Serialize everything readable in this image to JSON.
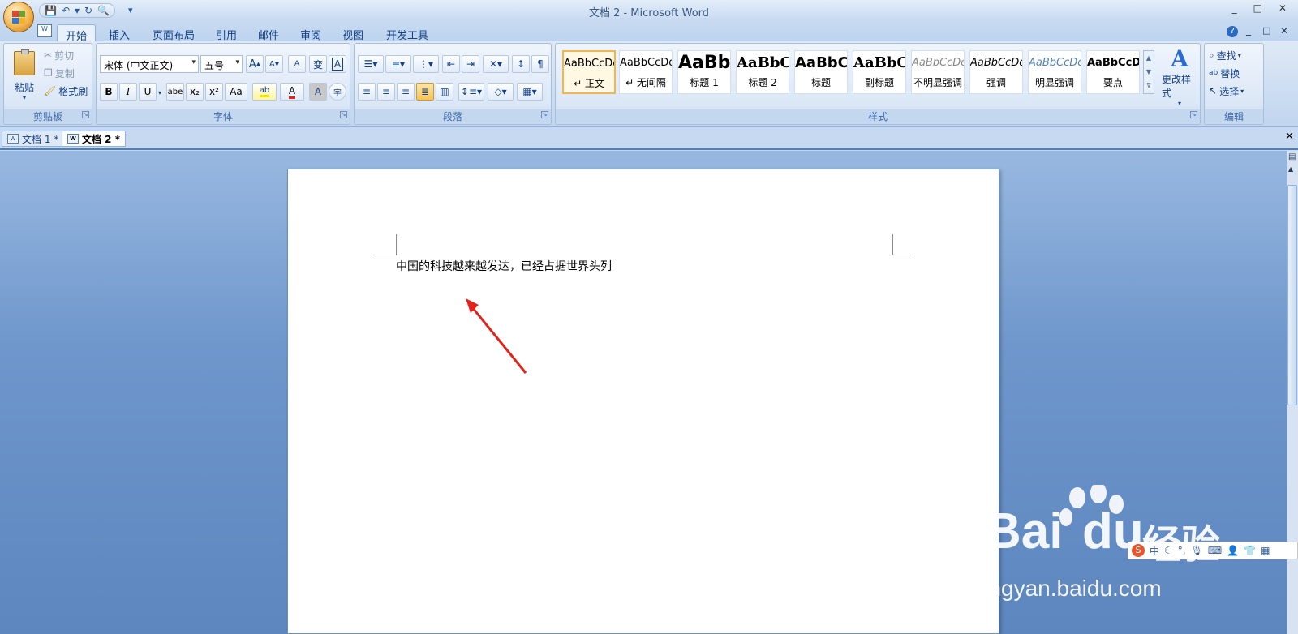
{
  "window": {
    "title": "文档 2 - Microsoft Word",
    "controls": [
      "_",
      "□",
      "✕"
    ]
  },
  "qat": {
    "save": "💾",
    "undo": "↶",
    "undo_menu": "▾",
    "redo": "↻",
    "preview": "🔍",
    "customize": "▾"
  },
  "tabs": [
    "开始",
    "插入",
    "页面布局",
    "引用",
    "邮件",
    "审阅",
    "视图",
    "开发工具"
  ],
  "ribbon_right": {
    "help": "?",
    "min": "_",
    "restore": "□",
    "close": "✕"
  },
  "clipboard": {
    "paste": "粘贴",
    "cut": "剪切",
    "copy": "复制",
    "format_painter": "格式刷",
    "caption": "剪贴板"
  },
  "font": {
    "name": "宋体 (中文正文)",
    "size": "五号",
    "grow": "A",
    "shrink": "A",
    "clear": "A",
    "pinyin": "wén",
    "phonetic": "变",
    "border": "A",
    "bold": "B",
    "italic": "I",
    "underline": "U",
    "strike": "abe",
    "sub": "x₂",
    "sup": "x²",
    "case": "Aa",
    "highlight": "ab",
    "color": "A",
    "shade": "A",
    "enclose": "字",
    "caption": "字体"
  },
  "paragraph": {
    "caption": "段落"
  },
  "styles": {
    "items": [
      {
        "sample": "AaBbCcDd",
        "label": "↵ 正文"
      },
      {
        "sample": "AaBbCcDd",
        "label": "↵ 无间隔"
      },
      {
        "sample": "AaBb",
        "label": "标题 1"
      },
      {
        "sample": "AaBbC",
        "label": "标题 2"
      },
      {
        "sample": "AaBbC",
        "label": "标题"
      },
      {
        "sample": "AaBbC",
        "label": "副标题"
      },
      {
        "sample": "AaBbCcDd",
        "label": "不明显强调"
      },
      {
        "sample": "AaBbCcDd",
        "label": "强调"
      },
      {
        "sample": "AaBbCcDd",
        "label": "明显强调"
      },
      {
        "sample": "AaBbCcDd",
        "label": "要点"
      }
    ],
    "change": "更改样式",
    "caption": "样式"
  },
  "editing": {
    "find": "查找",
    "replace": "替换",
    "select": "选择",
    "caption": "编辑"
  },
  "doc_tabs": [
    "文档 1 *",
    "文档 2 *"
  ],
  "document": {
    "text": "中国的科技越来越发达，已经占据世界头列"
  },
  "watermark": {
    "brand_a": "Bai",
    "brand_b": "du",
    "cn": "经验",
    "url": "jingyan.baidu.com"
  },
  "ime": {
    "label": "中"
  },
  "colors": {
    "arrow": "#e3221c",
    "accent": "#4f7ebc"
  }
}
